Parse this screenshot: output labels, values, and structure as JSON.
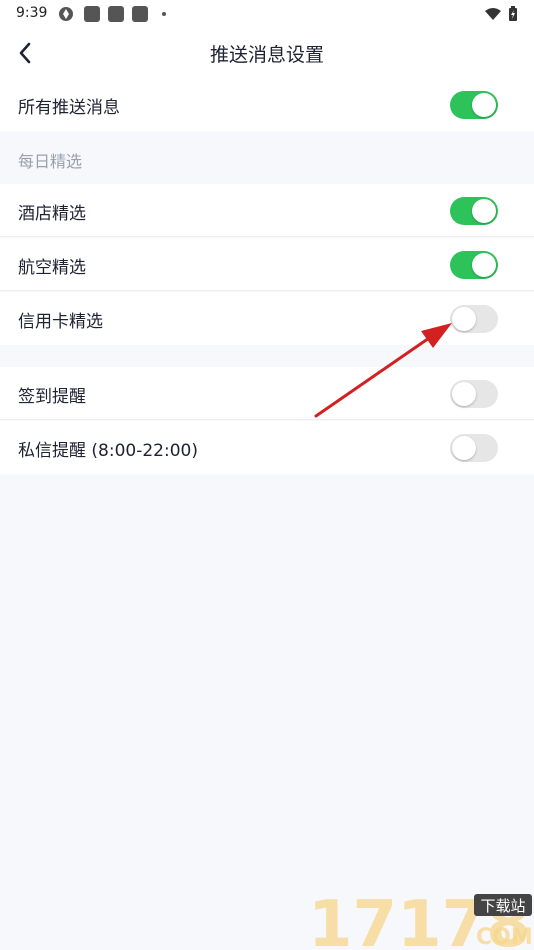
{
  "status_bar": {
    "time": "9:39"
  },
  "header": {
    "title": "推送消息设置"
  },
  "settings": {
    "all_push": {
      "label": "所有推送消息",
      "on": true
    },
    "section_daily": "每日精选",
    "hotel": {
      "label": "酒店精选",
      "on": true
    },
    "flight": {
      "label": "航空精选",
      "on": true
    },
    "credit_card": {
      "label": "信用卡精选",
      "on": false
    },
    "checkin": {
      "label": "签到提醒",
      "on": false
    },
    "private_msg": {
      "label": "私信提醒 (8:00-22:00)",
      "on": false
    }
  },
  "watermark": {
    "digits": "17178",
    "tag": "下载站",
    "domain": "COM"
  },
  "colors": {
    "toggle_on": "#2ec35a",
    "toggle_off": "#e6e6e6",
    "annotation_arrow": "#d32020"
  }
}
